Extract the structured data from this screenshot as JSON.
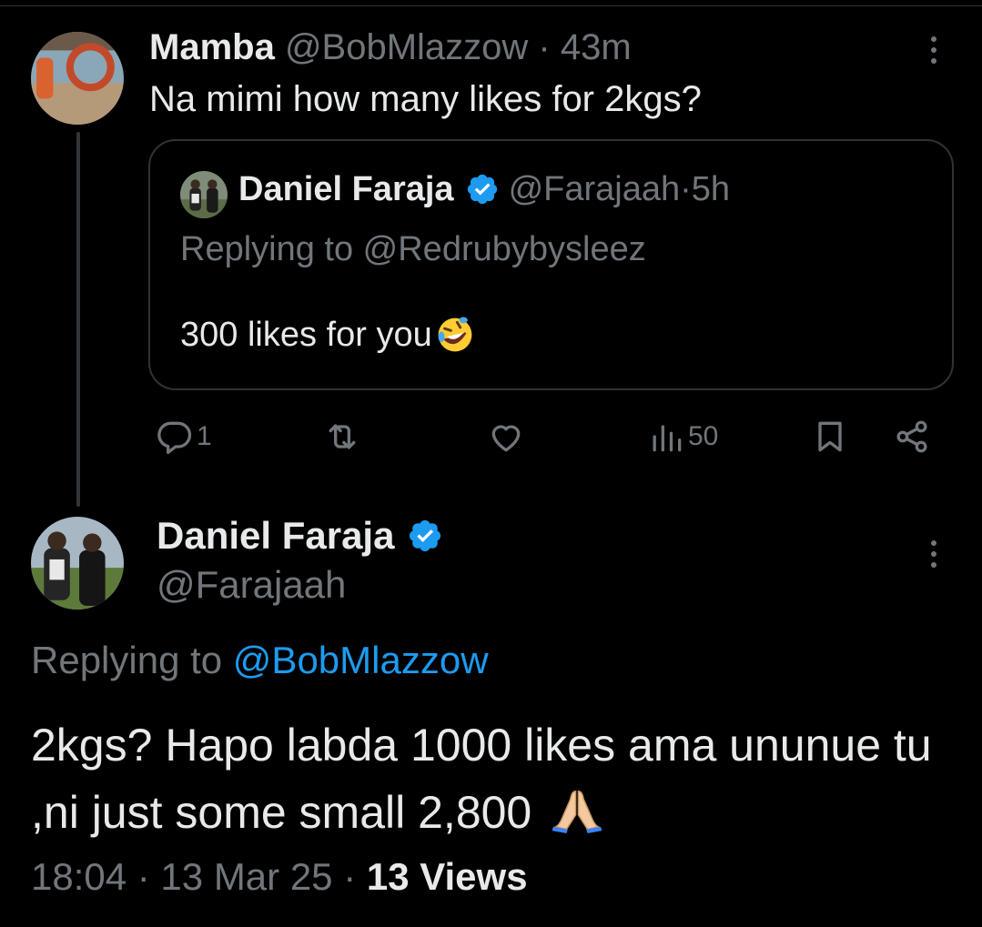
{
  "tweet1": {
    "author_name": "Mamba",
    "author_handle": "@BobMlazzow",
    "time_sep": " · ",
    "time": "43m",
    "text": "Na mimi how many likes for 2kgs?",
    "avatar_icon": "lifebuoy-avatar",
    "quote": {
      "author_name": "Daniel Faraja",
      "author_handle": "@Farajaah",
      "time_sep": " · ",
      "time": "5h",
      "replying_to": "Replying to @Redrubybysleez",
      "text": "300 likes for you",
      "emoji_icon": "rolling-on-floor-laughing-emoji"
    },
    "actions": {
      "reply_count": "1",
      "retweet_count": "",
      "like_count": "",
      "views_count": "50"
    }
  },
  "tweet2": {
    "author_name": "Daniel Faraja",
    "author_handle": "@Farajaah",
    "replying_prefix": "Replying to ",
    "replying_handle": "@BobMlazzow",
    "text": "2kgs? Hapo labda 1000 likes ama ununue tu ,ni just some small 2,800",
    "emoji_icon": "folded-hands-emoji",
    "timestamp": "18:04 · 13 Mar 25 · ",
    "views": "13 Views"
  },
  "colors": {
    "background": "#000000",
    "text": "#e7e9ea",
    "muted": "#71767b",
    "link": "#1d9bf0",
    "border": "#2f3336",
    "verified": "#1d9bf0"
  }
}
